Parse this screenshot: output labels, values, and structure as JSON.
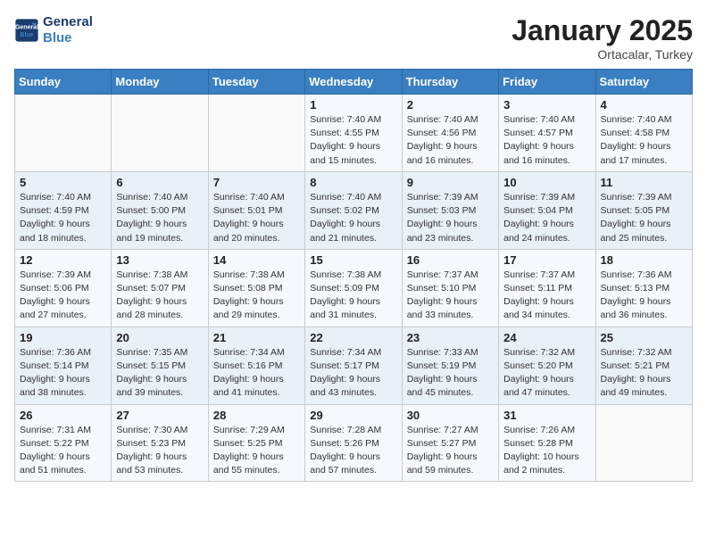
{
  "header": {
    "logo_line1": "General",
    "logo_line2": "Blue",
    "month": "January 2025",
    "location": "Ortacalar, Turkey"
  },
  "weekdays": [
    "Sunday",
    "Monday",
    "Tuesday",
    "Wednesday",
    "Thursday",
    "Friday",
    "Saturday"
  ],
  "weeks": [
    [
      {
        "day": "",
        "info": ""
      },
      {
        "day": "",
        "info": ""
      },
      {
        "day": "",
        "info": ""
      },
      {
        "day": "1",
        "info": "Sunrise: 7:40 AM\nSunset: 4:55 PM\nDaylight: 9 hours\nand 15 minutes."
      },
      {
        "day": "2",
        "info": "Sunrise: 7:40 AM\nSunset: 4:56 PM\nDaylight: 9 hours\nand 16 minutes."
      },
      {
        "day": "3",
        "info": "Sunrise: 7:40 AM\nSunset: 4:57 PM\nDaylight: 9 hours\nand 16 minutes."
      },
      {
        "day": "4",
        "info": "Sunrise: 7:40 AM\nSunset: 4:58 PM\nDaylight: 9 hours\nand 17 minutes."
      }
    ],
    [
      {
        "day": "5",
        "info": "Sunrise: 7:40 AM\nSunset: 4:59 PM\nDaylight: 9 hours\nand 18 minutes."
      },
      {
        "day": "6",
        "info": "Sunrise: 7:40 AM\nSunset: 5:00 PM\nDaylight: 9 hours\nand 19 minutes."
      },
      {
        "day": "7",
        "info": "Sunrise: 7:40 AM\nSunset: 5:01 PM\nDaylight: 9 hours\nand 20 minutes."
      },
      {
        "day": "8",
        "info": "Sunrise: 7:40 AM\nSunset: 5:02 PM\nDaylight: 9 hours\nand 21 minutes."
      },
      {
        "day": "9",
        "info": "Sunrise: 7:39 AM\nSunset: 5:03 PM\nDaylight: 9 hours\nand 23 minutes."
      },
      {
        "day": "10",
        "info": "Sunrise: 7:39 AM\nSunset: 5:04 PM\nDaylight: 9 hours\nand 24 minutes."
      },
      {
        "day": "11",
        "info": "Sunrise: 7:39 AM\nSunset: 5:05 PM\nDaylight: 9 hours\nand 25 minutes."
      }
    ],
    [
      {
        "day": "12",
        "info": "Sunrise: 7:39 AM\nSunset: 5:06 PM\nDaylight: 9 hours\nand 27 minutes."
      },
      {
        "day": "13",
        "info": "Sunrise: 7:38 AM\nSunset: 5:07 PM\nDaylight: 9 hours\nand 28 minutes."
      },
      {
        "day": "14",
        "info": "Sunrise: 7:38 AM\nSunset: 5:08 PM\nDaylight: 9 hours\nand 29 minutes."
      },
      {
        "day": "15",
        "info": "Sunrise: 7:38 AM\nSunset: 5:09 PM\nDaylight: 9 hours\nand 31 minutes."
      },
      {
        "day": "16",
        "info": "Sunrise: 7:37 AM\nSunset: 5:10 PM\nDaylight: 9 hours\nand 33 minutes."
      },
      {
        "day": "17",
        "info": "Sunrise: 7:37 AM\nSunset: 5:11 PM\nDaylight: 9 hours\nand 34 minutes."
      },
      {
        "day": "18",
        "info": "Sunrise: 7:36 AM\nSunset: 5:13 PM\nDaylight: 9 hours\nand 36 minutes."
      }
    ],
    [
      {
        "day": "19",
        "info": "Sunrise: 7:36 AM\nSunset: 5:14 PM\nDaylight: 9 hours\nand 38 minutes."
      },
      {
        "day": "20",
        "info": "Sunrise: 7:35 AM\nSunset: 5:15 PM\nDaylight: 9 hours\nand 39 minutes."
      },
      {
        "day": "21",
        "info": "Sunrise: 7:34 AM\nSunset: 5:16 PM\nDaylight: 9 hours\nand 41 minutes."
      },
      {
        "day": "22",
        "info": "Sunrise: 7:34 AM\nSunset: 5:17 PM\nDaylight: 9 hours\nand 43 minutes."
      },
      {
        "day": "23",
        "info": "Sunrise: 7:33 AM\nSunset: 5:19 PM\nDaylight: 9 hours\nand 45 minutes."
      },
      {
        "day": "24",
        "info": "Sunrise: 7:32 AM\nSunset: 5:20 PM\nDaylight: 9 hours\nand 47 minutes."
      },
      {
        "day": "25",
        "info": "Sunrise: 7:32 AM\nSunset: 5:21 PM\nDaylight: 9 hours\nand 49 minutes."
      }
    ],
    [
      {
        "day": "26",
        "info": "Sunrise: 7:31 AM\nSunset: 5:22 PM\nDaylight: 9 hours\nand 51 minutes."
      },
      {
        "day": "27",
        "info": "Sunrise: 7:30 AM\nSunset: 5:23 PM\nDaylight: 9 hours\nand 53 minutes."
      },
      {
        "day": "28",
        "info": "Sunrise: 7:29 AM\nSunset: 5:25 PM\nDaylight: 9 hours\nand 55 minutes."
      },
      {
        "day": "29",
        "info": "Sunrise: 7:28 AM\nSunset: 5:26 PM\nDaylight: 9 hours\nand 57 minutes."
      },
      {
        "day": "30",
        "info": "Sunrise: 7:27 AM\nSunset: 5:27 PM\nDaylight: 9 hours\nand 59 minutes."
      },
      {
        "day": "31",
        "info": "Sunrise: 7:26 AM\nSunset: 5:28 PM\nDaylight: 10 hours\nand 2 minutes."
      },
      {
        "day": "",
        "info": ""
      }
    ]
  ]
}
